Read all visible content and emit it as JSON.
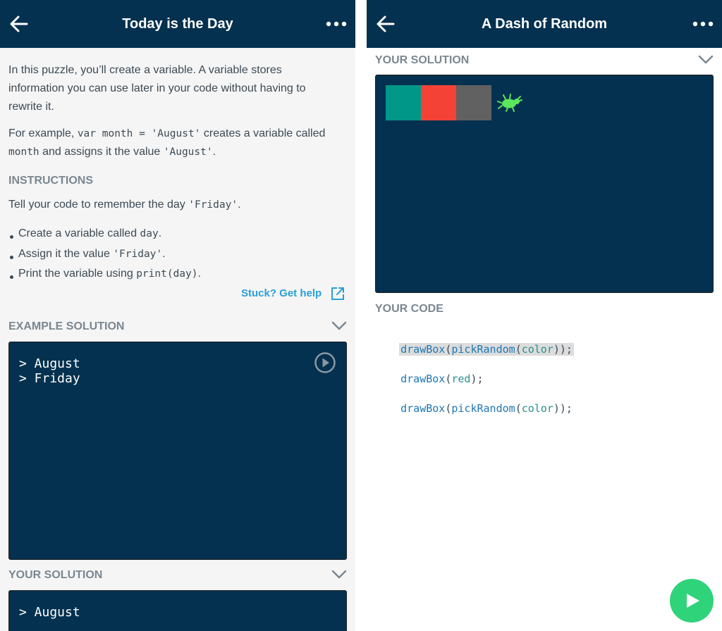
{
  "left": {
    "title": "Today is the Day",
    "intro": "In this puzzle, you’ll create a variable. A variable stores information you can use later in your code without having to rewrite it.",
    "example": {
      "prefix": "For example, ",
      "code1": "var month = 'August'",
      "middle": " creates a variable called ",
      "code2": "month",
      "middle2": " and assigns it the value ",
      "code3": "'August'",
      "suffix": "."
    },
    "instructions_heading": "INSTRUCTIONS",
    "instructions": {
      "prefix": "Tell your code to remember the day ",
      "code": "'Friday'",
      "suffix": "."
    },
    "bullets": [
      {
        "text": "Create a variable called ",
        "code": "day",
        "suffix": "."
      },
      {
        "text": "Assign it the value ",
        "code": "'Friday'",
        "suffix": "."
      },
      {
        "text": "Print the variable using ",
        "code": "print(day)",
        "suffix": "."
      }
    ],
    "help_link": "Stuck? Get help",
    "example_solution_heading": "EXAMPLE SOLUTION",
    "example_output": [
      "> August",
      "> Friday"
    ],
    "your_solution_heading": "YOUR SOLUTION",
    "your_output": [
      "> August"
    ]
  },
  "right": {
    "title": "A Dash of Random",
    "your_solution_heading": "YOUR SOLUTION",
    "boxes": [
      "#009688",
      "#f44336",
      "#616161"
    ],
    "your_code_heading": "YOUR CODE",
    "code": [
      {
        "fn": "drawBox",
        "open": "(",
        "inner_fn": "pickRandom",
        "inner_open": "(",
        "arg": "color",
        "close": "));"
      },
      {
        "fn": "drawBox",
        "open": "(",
        "arg": "red",
        "close": ");"
      },
      {
        "fn": "drawBox",
        "open": "(",
        "inner_fn": "pickRandom",
        "inner_open": "(",
        "arg": "color",
        "close": "));"
      }
    ]
  },
  "colors": {
    "topbar": "#04314f",
    "console": "#04314f",
    "link": "#2a9fd8",
    "run_button": "#2fd37a",
    "bug": "#5ce65c"
  },
  "icons": {
    "back": "arrow-left-icon",
    "more": "more-dots-icon",
    "chevron": "chevron-down-icon",
    "external": "external-link-icon",
    "play": "play-circle-icon",
    "bug": "bug-icon",
    "run": "play-icon"
  }
}
